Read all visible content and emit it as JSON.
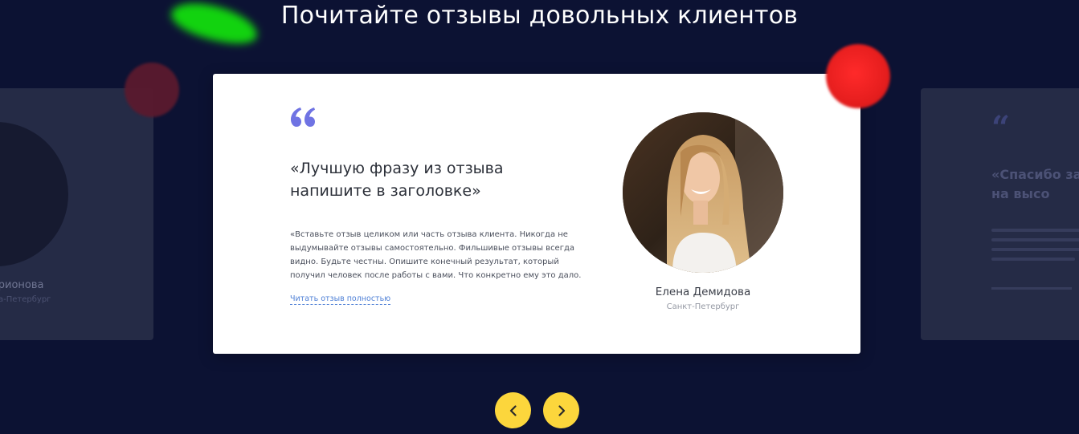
{
  "section": {
    "title": "Почитайте отзывы довольных клиентов"
  },
  "colors": {
    "background": "#0c1233",
    "card": "#ffffff",
    "accent_quote": "#6f73e3",
    "link": "#4d7fd6",
    "nav_button": "#fcd63c"
  },
  "left_card": {
    "name": "Ларионова",
    "city": "а-Петербург"
  },
  "main_card": {
    "quote_icon": "quote-icon",
    "heading": "«Лучшую фразу из отзыва напишите в заголовке»",
    "text": "«Вставьте отзыв целиком или часть отзыва клиента. Никогда не выдумывайте отзывы самостоятельно. Фильшивые отзывы всегда видно. Будьте честны. Опишите конечный результат, который получил человек после работы с вами. Что конкретно ему это дало. Можно",
    "read_more": "Читать отзыв полностью",
    "person_name": "Елена Демидова",
    "person_city": "Санкт-Петербург"
  },
  "right_card": {
    "heading": "«Спасибо за все на высо"
  },
  "navigation": {
    "prev_icon": "chevron-left-icon",
    "next_icon": "chevron-right-icon"
  }
}
